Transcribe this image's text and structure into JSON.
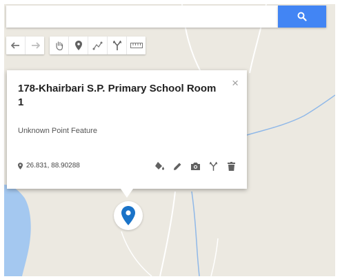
{
  "search": {
    "placeholder": "",
    "value": ""
  },
  "toolbar": {
    "tools": [
      {
        "id": "undo",
        "icon": "undo-icon"
      },
      {
        "id": "redo",
        "icon": "redo-icon"
      },
      {
        "id": "pan",
        "icon": "hand-icon"
      },
      {
        "id": "add-marker",
        "icon": "marker-icon"
      },
      {
        "id": "draw-line",
        "icon": "draw-line-icon"
      },
      {
        "id": "directions",
        "icon": "directions-icon"
      },
      {
        "id": "measure",
        "icon": "ruler-icon"
      }
    ]
  },
  "info_card": {
    "title": "178-Khairbari S.P. Primary School Room 1",
    "feature_type": "Unknown Point Feature",
    "coordinates": "26.831, 88.90288",
    "close_label": "×",
    "actions": [
      {
        "id": "style",
        "icon": "paint-bucket-icon"
      },
      {
        "id": "edit",
        "icon": "pencil-icon"
      },
      {
        "id": "photo",
        "icon": "camera-icon"
      },
      {
        "id": "directions",
        "icon": "directions-icon"
      },
      {
        "id": "delete",
        "icon": "trash-icon"
      }
    ]
  },
  "colors": {
    "map_land": "#ece9e1",
    "water": "#a4c8f0",
    "river": "#8fb8e8",
    "accent": "#4285f4",
    "marker": "#1a73c8",
    "icon_gray": "#757575"
  }
}
